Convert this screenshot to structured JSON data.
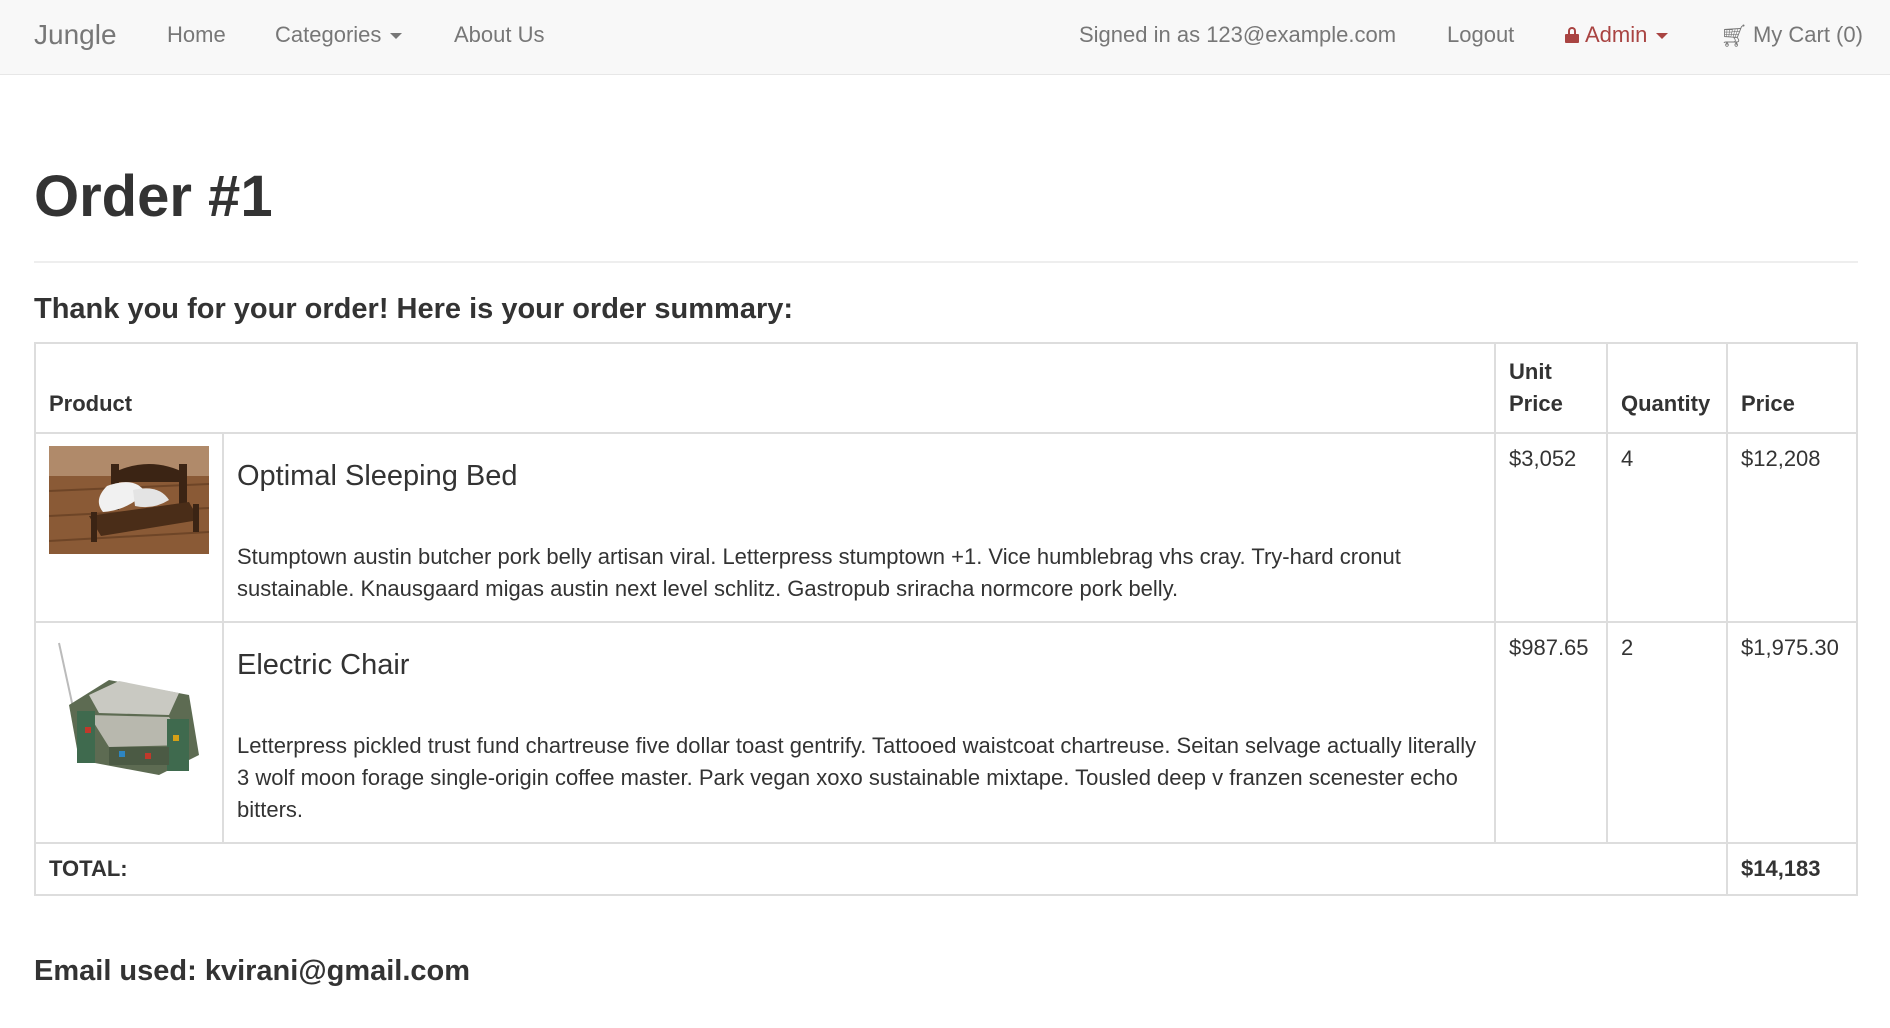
{
  "navbar": {
    "brand": "Jungle",
    "home": "Home",
    "categories": "Categories",
    "about": "About Us",
    "signed_in": "Signed in as 123@example.com",
    "logout": "Logout",
    "admin": "Admin",
    "cart": "My Cart (0)"
  },
  "page": {
    "title": "Order #1",
    "summary": "Thank you for your order! Here is your order summary:",
    "email_used": "Email used: kvirani@gmail.com"
  },
  "table": {
    "headers": {
      "product": "Product",
      "unit_price_1": "Unit",
      "unit_price_2": "Price",
      "quantity": "Quantity",
      "price": "Price"
    },
    "rows": [
      {
        "name": "Optimal Sleeping Bed",
        "description": "Stumptown austin butcher pork belly artisan viral. Letterpress stumptown +1. Vice humblebrag vhs cray. Try-hard cronut sustainable. Knausgaard migas austin next level schlitz. Gastropub sriracha normcore pork belly.",
        "unit_price": "$3,052",
        "quantity": "4",
        "price": "$12,208"
      },
      {
        "name": "Electric Chair",
        "description": "Letterpress pickled trust fund chartreuse five dollar toast gentrify. Tattooed waistcoat chartreuse. Seitan selvage actually literally 3 wolf moon forage single-origin coffee master. Park vegan xoxo sustainable mixtape. Tousled deep v franzen scenester echo bitters.",
        "unit_price": "$987.65",
        "quantity": "2",
        "price": "$1,975.30"
      }
    ],
    "total_label": "TOTAL:",
    "total_value": "$14,183"
  },
  "colors": {
    "navbar_bg": "#f8f8f8",
    "admin_accent": "#a94442",
    "text": "#333333",
    "nav_text": "#777777"
  }
}
